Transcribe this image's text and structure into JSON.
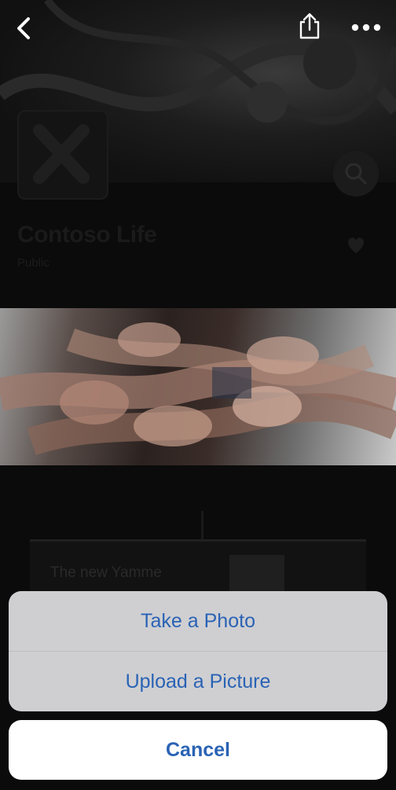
{
  "group": {
    "title": "Contoso Life",
    "privacy": "Public"
  },
  "post": {
    "preview_text": "The new Yamme"
  },
  "action_sheet": {
    "options": [
      {
        "label": "Take a Photo"
      },
      {
        "label": "Upload a Picture"
      }
    ],
    "cancel_label": "Cancel"
  },
  "icons": {
    "back": "chevron-left-icon",
    "share": "share-icon",
    "more": "more-horizontal-icon",
    "search": "search-icon",
    "favorite": "heart-icon"
  },
  "colors": {
    "accent": "#2a63b4",
    "sheet_bg": "#cfcfd2",
    "overlay": "#0b0b0b"
  }
}
